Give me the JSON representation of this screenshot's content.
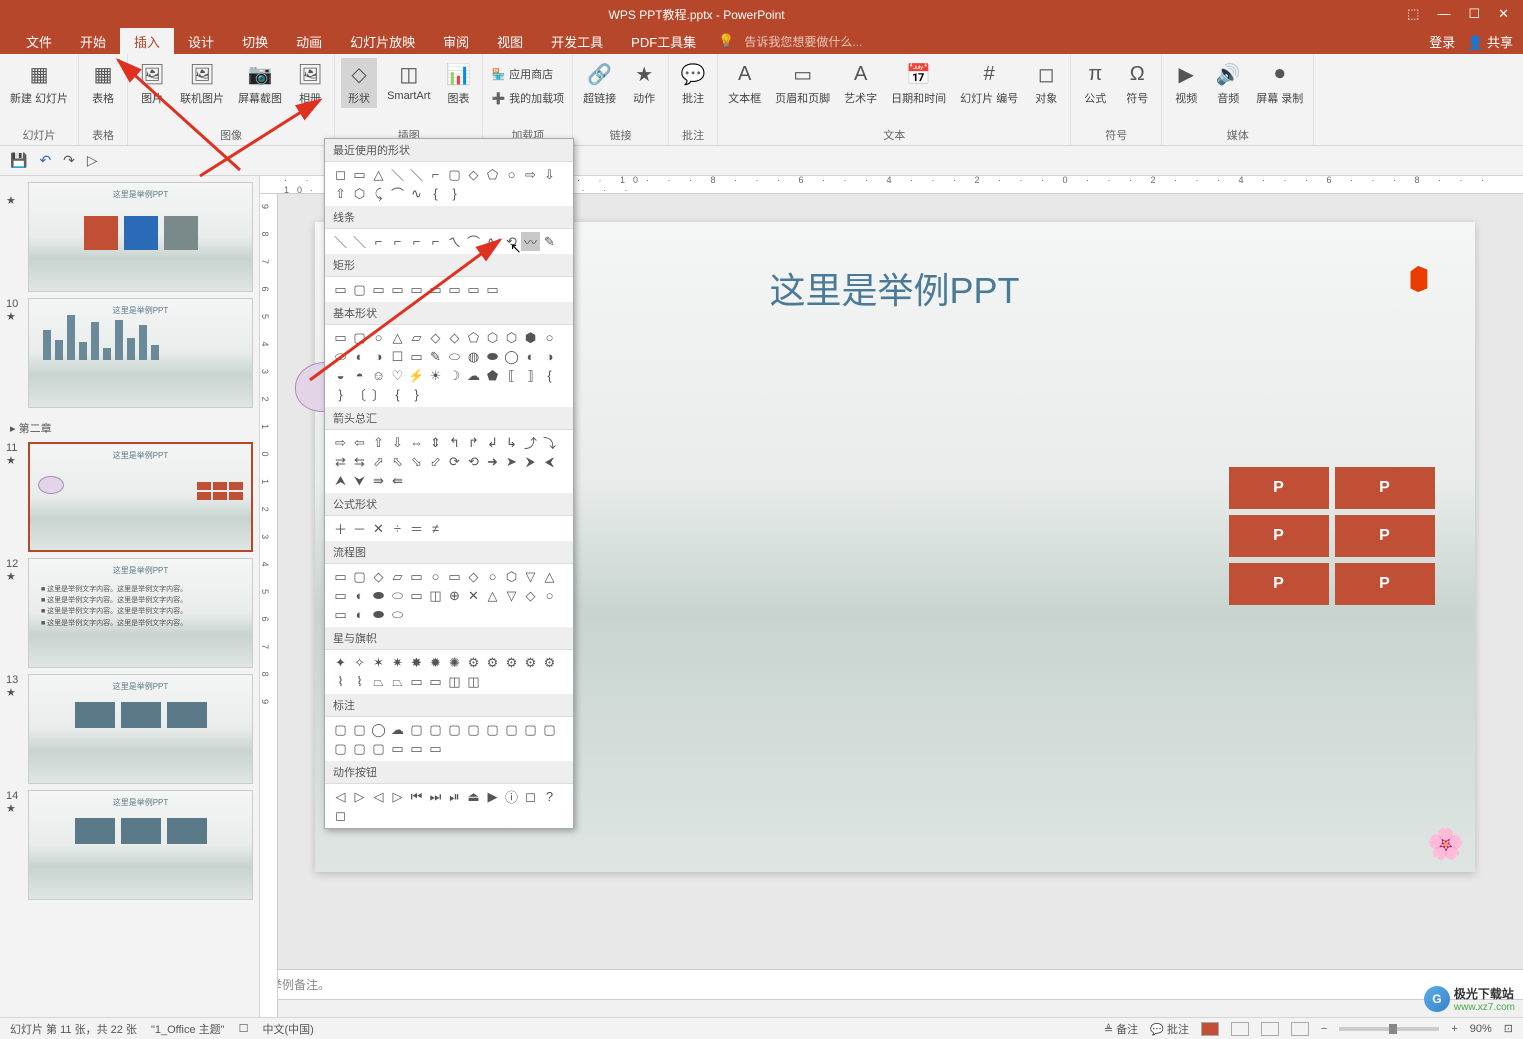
{
  "title": "WPS PPT教程.pptx - PowerPoint",
  "win_controls": {
    "opts": "⬚",
    "min": "—",
    "max": "☐",
    "close": "✕"
  },
  "menu": {
    "tabs": [
      "文件",
      "开始",
      "插入",
      "设计",
      "切换",
      "动画",
      "幻灯片放映",
      "审阅",
      "视图",
      "开发工具",
      "PDF工具集"
    ],
    "active_index": 2,
    "tell_me": "告诉我您想要做什么...",
    "tell_me_icon": "💡",
    "login": "登录",
    "share": "共享"
  },
  "ribbon": {
    "groups": [
      {
        "label": "幻灯片",
        "items": [
          {
            "icon": "▦",
            "lbl": "新建\n幻灯片"
          }
        ]
      },
      {
        "label": "表格",
        "items": [
          {
            "icon": "▦",
            "lbl": "表格"
          }
        ]
      },
      {
        "label": "图像",
        "items": [
          {
            "icon": "🖼",
            "lbl": "图片"
          },
          {
            "icon": "🖼",
            "lbl": "联机图片"
          },
          {
            "icon": "📷",
            "lbl": "屏幕截图"
          },
          {
            "icon": "🖼",
            "lbl": "相册"
          }
        ]
      },
      {
        "label": "插图",
        "items": [
          {
            "icon": "◇",
            "lbl": "形状",
            "active": true
          },
          {
            "icon": "◫",
            "lbl": "SmartArt"
          },
          {
            "icon": "📊",
            "lbl": "图表"
          }
        ]
      },
      {
        "label": "加载项",
        "small_items": [
          {
            "icon": "🏪",
            "lbl": "应用商店"
          },
          {
            "icon": "➕",
            "lbl": "我的加载项"
          }
        ]
      },
      {
        "label": "链接",
        "items": [
          {
            "icon": "🔗",
            "lbl": "超链接"
          },
          {
            "icon": "★",
            "lbl": "动作"
          }
        ]
      },
      {
        "label": "批注",
        "items": [
          {
            "icon": "💬",
            "lbl": "批注"
          }
        ]
      },
      {
        "label": "文本",
        "items": [
          {
            "icon": "A",
            "lbl": "文本框"
          },
          {
            "icon": "▭",
            "lbl": "页眉和页脚"
          },
          {
            "icon": "A",
            "lbl": "艺术字"
          },
          {
            "icon": "📅",
            "lbl": "日期和时间"
          },
          {
            "icon": "#",
            "lbl": "幻灯片\n编号"
          },
          {
            "icon": "◻",
            "lbl": "对象"
          }
        ]
      },
      {
        "label": "符号",
        "items": [
          {
            "icon": "π",
            "lbl": "公式"
          },
          {
            "icon": "Ω",
            "lbl": "符号"
          }
        ]
      },
      {
        "label": "媒体",
        "items": [
          {
            "icon": "▶",
            "lbl": "视频"
          },
          {
            "icon": "🔊",
            "lbl": "音频"
          },
          {
            "icon": "⏺",
            "lbl": "屏幕\n录制"
          }
        ]
      }
    ]
  },
  "qat": {
    "save": "💾",
    "undo": "↶",
    "redo": "↷",
    "start": "▷"
  },
  "thumbs": {
    "section1_title": "这里是举例PPT",
    "section2": "▸ 第二章",
    "slides": [
      {
        "num": "",
        "type": "apps"
      },
      {
        "num": "10",
        "type": "chart"
      },
      {
        "num": "11",
        "type": "cloud-red",
        "selected": true
      },
      {
        "num": "12",
        "type": "text"
      },
      {
        "num": "13",
        "type": "boxes"
      },
      {
        "num": "14",
        "type": "boxes2"
      }
    ],
    "text_lines": [
      "这里是举例文字内容。这里是举例文字内容。",
      "这里是举例文字内容。这里是举例文字内容。",
      "这里是举例文字内容。这里是举例文字内容。",
      "这里是举例文字内容。这里是举例文字内容。"
    ],
    "mini_title": "这里是举例PPT"
  },
  "shapes_popup": {
    "sections": [
      {
        "title": "最近使用的形状",
        "glyphs": [
          "◻",
          "▭",
          "△",
          "＼",
          "＼",
          "⌐",
          "▢",
          "◇",
          "⬠",
          "○",
          "⇨",
          "⇩",
          "⇧",
          "⬡",
          "⤹",
          "⌒",
          "∿",
          "{",
          "}"
        ]
      },
      {
        "title": "线条",
        "glyphs": [
          "＼",
          "＼",
          "⌐",
          "⌐",
          "⌐",
          "⌐",
          "ㄟ",
          "⌒",
          "∿",
          "⟲",
          "〰",
          "✎"
        ],
        "hl_index": 10
      },
      {
        "title": "矩形",
        "glyphs": [
          "▭",
          "▢",
          "▭",
          "▭",
          "▭",
          "▭",
          "▭",
          "▭",
          "▭"
        ]
      },
      {
        "title": "基本形状",
        "glyphs": [
          "▭",
          "▢",
          "○",
          "△",
          "▱",
          "◇",
          "◇",
          "⬠",
          "⬡",
          "⬡",
          "⬢",
          "○",
          "⬭",
          "◐",
          "◑",
          "☐",
          "▭",
          "✎",
          "⬭",
          "◍",
          "⬬",
          "◯",
          "◐",
          "◑",
          "◒",
          "◓",
          "☺",
          "♡",
          "⚡",
          "☀",
          "☽",
          "☁",
          "⬟",
          "⟦",
          "⟧",
          "{",
          "}",
          "〔",
          "〕",
          "{",
          "}"
        ]
      },
      {
        "title": "箭头总汇",
        "glyphs": [
          "⇨",
          "⇦",
          "⇧",
          "⇩",
          "⇔",
          "⇕",
          "↰",
          "↱",
          "↲",
          "↳",
          "⤴",
          "⤵",
          "⇄",
          "⇆",
          "⬀",
          "⬁",
          "⬂",
          "⬃",
          "⟳",
          "⟲",
          "➜",
          "➤",
          "⮞",
          "⮜",
          "⮝",
          "⮟",
          "⇛",
          "⇚"
        ]
      },
      {
        "title": "公式形状",
        "glyphs": [
          "＋",
          "－",
          "✕",
          "÷",
          "＝",
          "≠"
        ]
      },
      {
        "title": "流程图",
        "glyphs": [
          "▭",
          "▢",
          "◇",
          "▱",
          "▭",
          "○",
          "▭",
          "◇",
          "○",
          "⬡",
          "▽",
          "△",
          "▭",
          "◐",
          "⬬",
          "⬭",
          "▭",
          "◫",
          "⊕",
          "✕",
          "△",
          "▽",
          "◇",
          "○",
          "▭",
          "◐",
          "⬬",
          "⬭"
        ]
      },
      {
        "title": "星与旗帜",
        "glyphs": [
          "✦",
          "✧",
          "✶",
          "✷",
          "✸",
          "✹",
          "✺",
          "⚙",
          "⚙",
          "⚙",
          "⚙",
          "⚙",
          "⌇",
          "⌇",
          "⏢",
          "⏢",
          "▭",
          "▭",
          "◫",
          "◫"
        ]
      },
      {
        "title": "标注",
        "glyphs": [
          "▢",
          "▢",
          "◯",
          "☁",
          "▢",
          "▢",
          "▢",
          "▢",
          "▢",
          "▢",
          "▢",
          "▢",
          "▢",
          "▢",
          "▢",
          "▭",
          "▭",
          "▭"
        ]
      },
      {
        "title": "动作按钮",
        "glyphs": [
          "◁",
          "▷",
          "◁",
          "▷",
          "⏮",
          "⏭",
          "⏯",
          "⏏",
          "▶",
          "ⓘ",
          "◻",
          "?",
          "◻"
        ]
      }
    ]
  },
  "slide": {
    "title": "这里是举例PPT",
    "red_labels": [
      "P",
      "P",
      "P",
      "P",
      "P",
      "P"
    ]
  },
  "notes": "举例备注。",
  "ruler": "· · · 16· · · 14· · · 12· · · 10· · · 8 · · · 6 · · · 4 · · · 2 · · · 0 · · · 2 · · · 4 · · · 6 · · · 8 · · · 10· · · 12· · · 14· · · 16· · ·",
  "ruler_v": "9  8  7  6  5  4  3  2  1  0  1  2  3  4  5  6  7  8  9",
  "status": {
    "slide_info": "幻灯片 第 11 张，共 22 张",
    "theme": "\"1_Office 主题\"",
    "lang_icon": "☐",
    "lang": "中文(中国)",
    "notes": "备注",
    "comments": "批注",
    "zoom": "90%",
    "fit": "⊡",
    "minus": "−",
    "plus": "+"
  },
  "watermark": {
    "text": "极光下载站",
    "url": "www.xz7.com"
  }
}
